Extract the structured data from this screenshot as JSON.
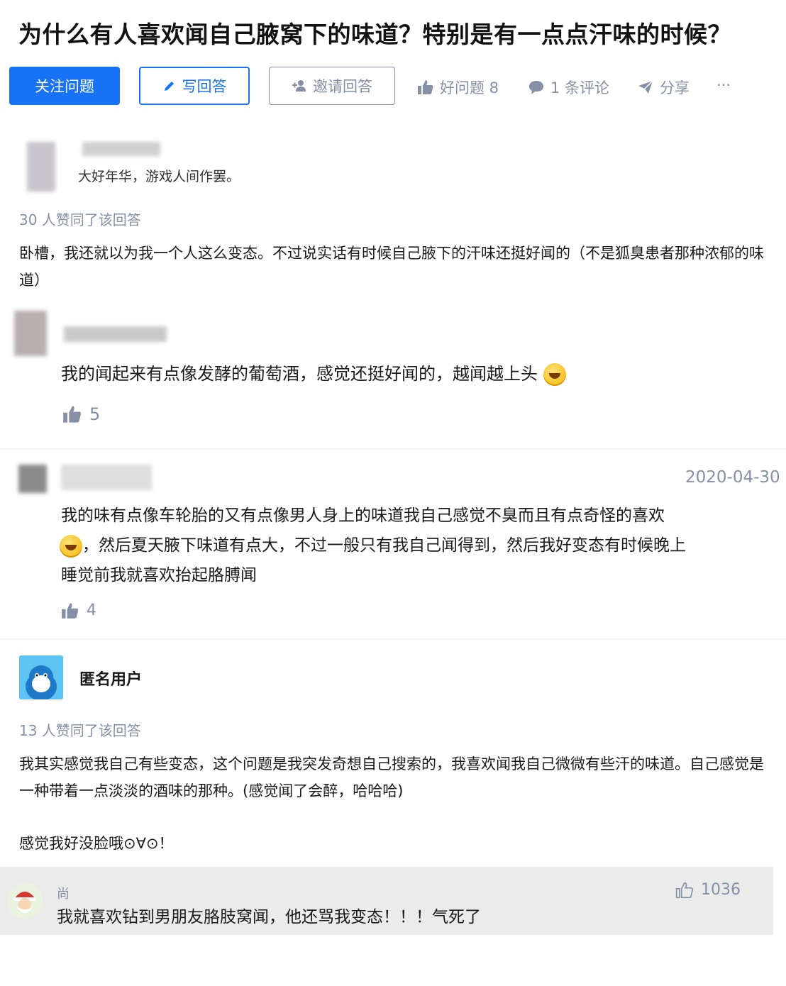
{
  "question": {
    "title": "为什么有人喜欢闻自己腋窝下的味道？特别是有一点点汗味的时候？"
  },
  "toolbar": {
    "follow_label": "关注问题",
    "write_label": "写回答",
    "invite_label": "邀请回答",
    "good_question_label": "好问题 8",
    "comments_label": "1 条评论",
    "share_label": "分享",
    "more_label": "···"
  },
  "answer1": {
    "author_bio": "大好年华，游戏人间作罢。",
    "votes": "30 人赞同了该回答",
    "content": "卧槽，我还就以为我一个人这么变态。不过说实话有时候自己腋下的汗味还挺好闻的（不是狐臭患者那种浓郁的味道）"
  },
  "comment1": {
    "text": "我的闻起来有点像发酵的葡萄酒，感觉还挺好闻的，越闻越上头",
    "likes": "5"
  },
  "comment2": {
    "date": "2020-04-30",
    "text_line1": "我的味有点像车轮胎的又有点像男人身上的味道我自己感觉不臭而且有点奇怪的喜欢",
    "text_line2": "，然后夏天腋下味道有点大，不过一般只有我自己闻得到，然后我好变态有时候晚上",
    "text_line3": "睡觉前我就喜欢抬起胳膊闻",
    "likes": "4"
  },
  "answer2": {
    "author": "匿名用户",
    "votes": "13 人赞同了该回答",
    "content_p1": "我其实感觉我自己有些变态，这个问题是我突发奇想自己搜索的，我喜欢闻我自己微微有些汗的味道。自己感觉是一种带着一点淡淡的酒味的那种。(感觉闻了会醉，哈哈哈)",
    "content_p2": "感觉我好没脸哦⊙∀⊙！"
  },
  "reply": {
    "author": "尚",
    "text": "我就喜欢钻到男朋友胳肢窝闻，他还骂我变态！！！气死了",
    "likes": "1036"
  },
  "colors": {
    "brand_blue": "#1772f6",
    "meta_gray": "#8590a6",
    "reply_bg": "#ebebeb"
  }
}
